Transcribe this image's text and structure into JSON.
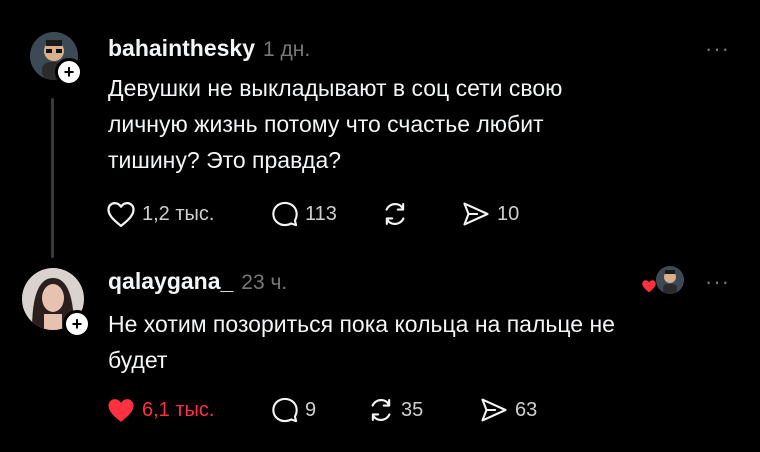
{
  "posts": [
    {
      "username": "bahainthesky",
      "time": "1 дн.",
      "text_lines": [
        "Девушки не выкладывают в соц сети свою",
        "личную жизнь потому что счастье любит",
        "тишину? Это правда?"
      ],
      "likes": "1,2 тыс.",
      "comments": "113",
      "reposts": "",
      "shares": "10",
      "liked": false
    },
    {
      "username": "qalaygana_",
      "time": "23 ч.",
      "text_lines": [
        "Не хотим позориться пока кольца на пальце не",
        "будет"
      ],
      "likes": "6,1 тыс.",
      "comments": "9",
      "reposts": "35",
      "shares": "63",
      "liked": true
    }
  ],
  "more_label": "···",
  "colors": {
    "like_active": "#ff3040",
    "muted": "#777777",
    "text": "#f3f5f7"
  }
}
